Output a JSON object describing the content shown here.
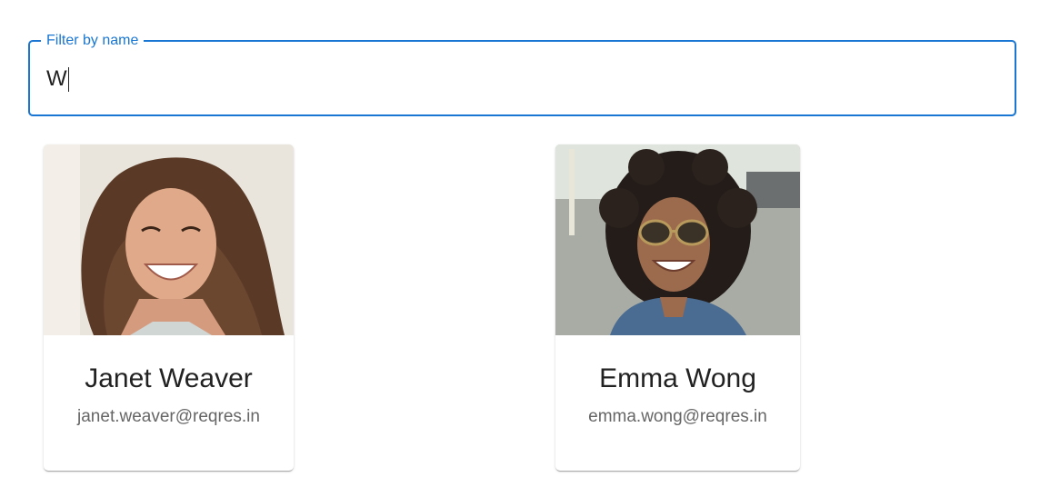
{
  "filter": {
    "label": "Filter by name",
    "value": "W",
    "accent_color": "#1976d2"
  },
  "users": [
    {
      "name": "Janet Weaver",
      "email": "janet.weaver@reqres.in",
      "avatar": "portrait-photo"
    },
    {
      "name": "Emma Wong",
      "email": "emma.wong@reqres.in",
      "avatar": "portrait-photo"
    }
  ]
}
